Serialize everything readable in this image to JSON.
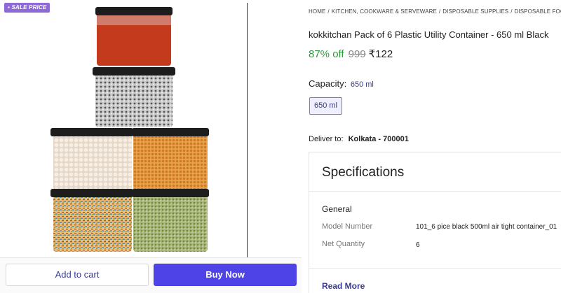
{
  "badge": {
    "label": "SALE PRICE"
  },
  "actions": {
    "add_to_cart": "Add to cart",
    "buy_now": "Buy Now"
  },
  "breadcrumb": [
    "HOME",
    "/",
    "KITCHEN, COOKWARE & SERVEWARE",
    "/",
    "DISPOSABLE SUPPLIES",
    "/",
    "DISPOSABLE FOOD CONTA"
  ],
  "product": {
    "title": "kokkitchan Pack of 6 Plastic Utility Container  - 650 ml Black",
    "discount": "87% off",
    "mrp": "999",
    "price": "₹122"
  },
  "capacity": {
    "label": "Capacity:",
    "value": "650 ml",
    "chip": "650 ml"
  },
  "delivery": {
    "label": "Deliver to:",
    "location": "Kolkata - 700001"
  },
  "specifications": {
    "title": "Specifications",
    "group": "General",
    "rows": [
      {
        "key": "Model Number",
        "value": "101_6 pice black 500ml air tight container_01"
      },
      {
        "key": "Net Quantity",
        "value": "6"
      }
    ],
    "read_more": "Read More"
  },
  "colors": {
    "accent": "#4d43e6",
    "discount_green": "#2e9b3a",
    "badge_purple": "#8e6ad6",
    "link": "#3a3a90"
  }
}
